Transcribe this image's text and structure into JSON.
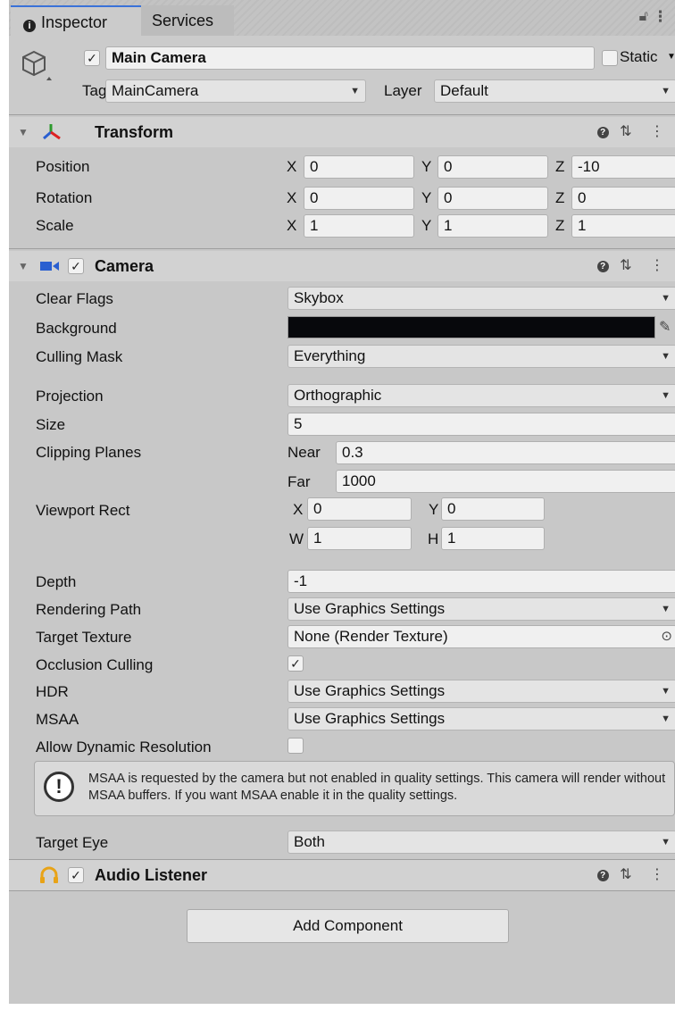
{
  "tabs": {
    "inspector": "Inspector",
    "services": "Services",
    "lock_icon": "lock-icon",
    "menu_icon": "kebab-menu-icon"
  },
  "object": {
    "active": true,
    "name": "Main Camera",
    "static_label": "Static",
    "tag_label": "Tag",
    "tag_value": "MainCamera",
    "layer_label": "Layer",
    "layer_value": "Default"
  },
  "transform": {
    "title": "Transform",
    "position_label": "Position",
    "rotation_label": "Rotation",
    "scale_label": "Scale",
    "axis_x": "X",
    "axis_y": "Y",
    "axis_z": "Z",
    "position": {
      "x": "0",
      "y": "0",
      "z": "-10"
    },
    "rotation": {
      "x": "0",
      "y": "0",
      "z": "0"
    },
    "scale": {
      "x": "1",
      "y": "1",
      "z": "1"
    }
  },
  "camera": {
    "title": "Camera",
    "enabled": true,
    "clear_flags_label": "Clear Flags",
    "clear_flags": "Skybox",
    "background_label": "Background",
    "background_color": "#07080c",
    "culling_mask_label": "Culling Mask",
    "culling_mask": "Everything",
    "projection_label": "Projection",
    "projection": "Orthographic",
    "size_label": "Size",
    "size": "5",
    "clipping_label": "Clipping Planes",
    "near_label": "Near",
    "near": "0.3",
    "far_label": "Far",
    "far": "1000",
    "viewport_label": "Viewport Rect",
    "vp_x_label": "X",
    "vp_x": "0",
    "vp_y_label": "Y",
    "vp_y": "0",
    "vp_w_label": "W",
    "vp_w": "1",
    "vp_h_label": "H",
    "vp_h": "1",
    "depth_label": "Depth",
    "depth": "-1",
    "rendering_path_label": "Rendering Path",
    "rendering_path": "Use Graphics Settings",
    "target_texture_label": "Target Texture",
    "target_texture": "None (Render Texture)",
    "occlusion_label": "Occlusion Culling",
    "occlusion": true,
    "hdr_label": "HDR",
    "hdr": "Use Graphics Settings",
    "msaa_label": "MSAA",
    "msaa": "Use Graphics Settings",
    "dynamic_res_label": "Allow Dynamic Resolution",
    "dynamic_res": false,
    "warning": "MSAA is requested by the camera but not enabled in quality settings. This camera will render without MSAA buffers. If you want MSAA enable it in the quality settings.",
    "target_eye_label": "Target Eye",
    "target_eye": "Both"
  },
  "audio_listener": {
    "title": "Audio Listener",
    "enabled": true
  },
  "add_component": "Add Component",
  "colors": {
    "accent_tab": "#3a72d8",
    "panel_bg": "#c8c8c8",
    "camera_icon": "#2a5fd0",
    "audio_icon": "#e8a317"
  }
}
